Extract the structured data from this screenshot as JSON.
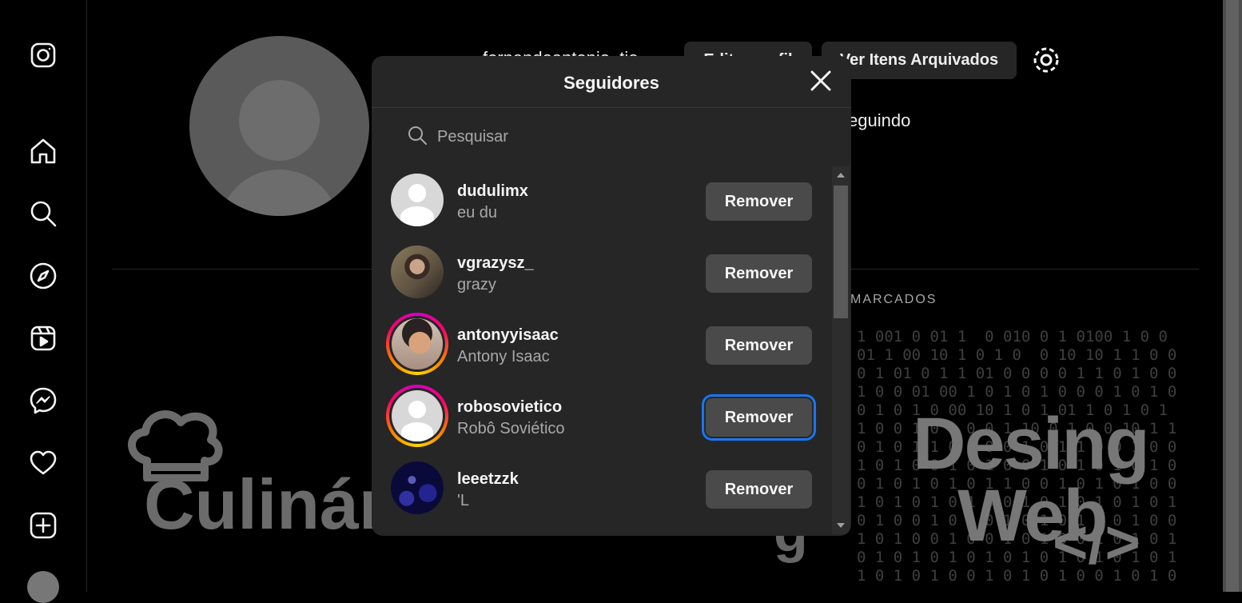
{
  "sidebar": {
    "icons": [
      "instagram-logo-icon",
      "home-icon",
      "search-icon",
      "explore-compass-icon",
      "reels-icon",
      "messenger-icon",
      "heart-icon",
      "create-plus-icon"
    ]
  },
  "profile_bg": {
    "buttons": [
      "Editar perfil",
      "Ver Itens Arquivados"
    ],
    "following_text": "seguindo",
    "tab_text": "MARCADOS",
    "post_left_text": "Culinária",
    "post_right_line1": "Desing",
    "post_right_line2": "Web",
    "post_right_code": "</>"
  },
  "modal": {
    "title": "Seguidores",
    "search_placeholder": "Pesquisar",
    "followers": [
      {
        "username": "dudulimx",
        "fullname": "eu du",
        "button": "Remover"
      },
      {
        "username": "vgrazysz_",
        "fullname": "grazy",
        "button": "Remover"
      },
      {
        "username": "antonyyisaac",
        "fullname": "Antony Isaac",
        "button": "Remover"
      },
      {
        "username": "robosovietico",
        "fullname": "Robô Soviético",
        "button": "Remover"
      },
      {
        "username": "leeetzzk",
        "fullname": "'L",
        "button": "Remover"
      }
    ]
  },
  "colors": {
    "background": "#000000",
    "modal": "#262626",
    "button": "#4a4a4a",
    "focus_ring": "#1877f2"
  }
}
